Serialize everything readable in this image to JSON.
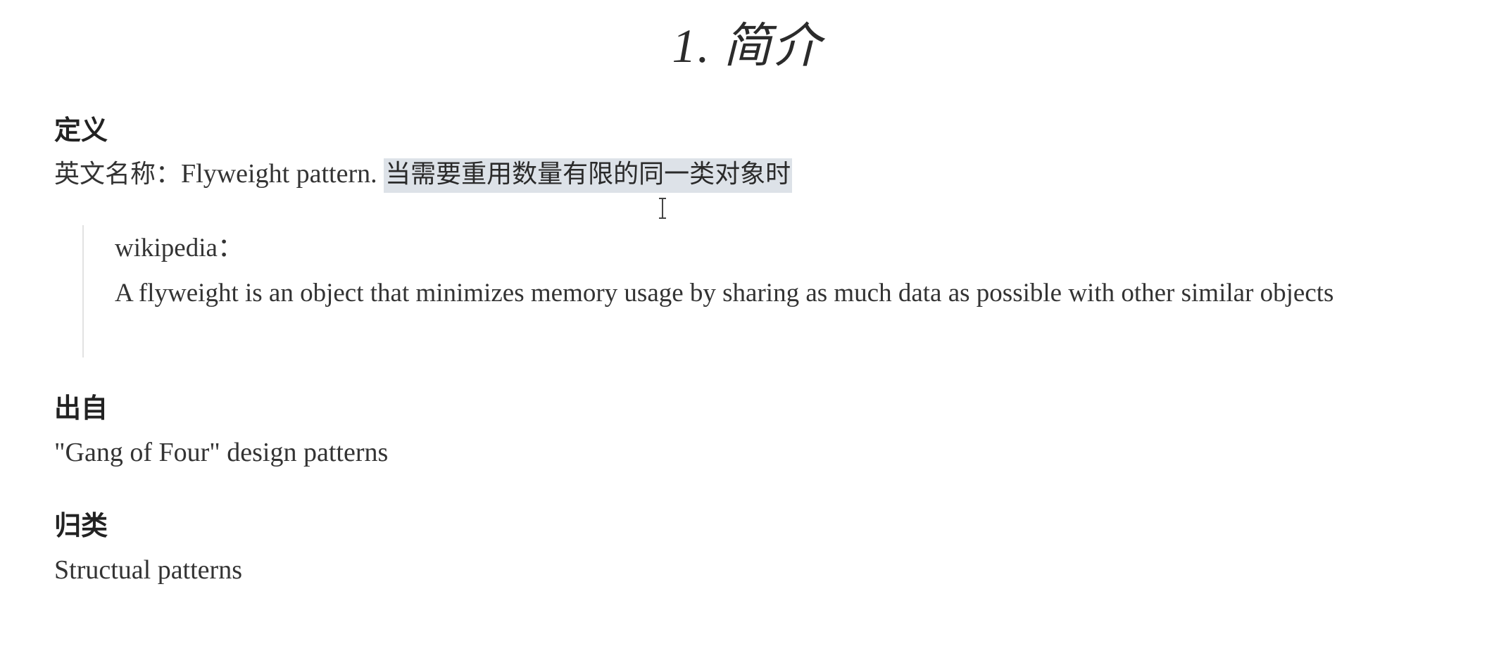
{
  "title": {
    "number": "1.",
    "text": "简介"
  },
  "sections": {
    "definition": {
      "heading": "定义",
      "label": "英文名称：",
      "english_name": "Flyweight pattern.",
      "highlighted": "当需要重用数量有限的同一类对象时",
      "quote": {
        "source": "wikipedia：",
        "body": "A flyweight is an object that minimizes memory usage by sharing as much data as possible with other similar objects"
      }
    },
    "origin": {
      "heading": "出自",
      "text": "\"Gang of Four\" design patterns"
    },
    "category": {
      "heading": "归类",
      "text": "Structual patterns"
    }
  },
  "cursor": {
    "icon": "text-cursor-icon"
  }
}
